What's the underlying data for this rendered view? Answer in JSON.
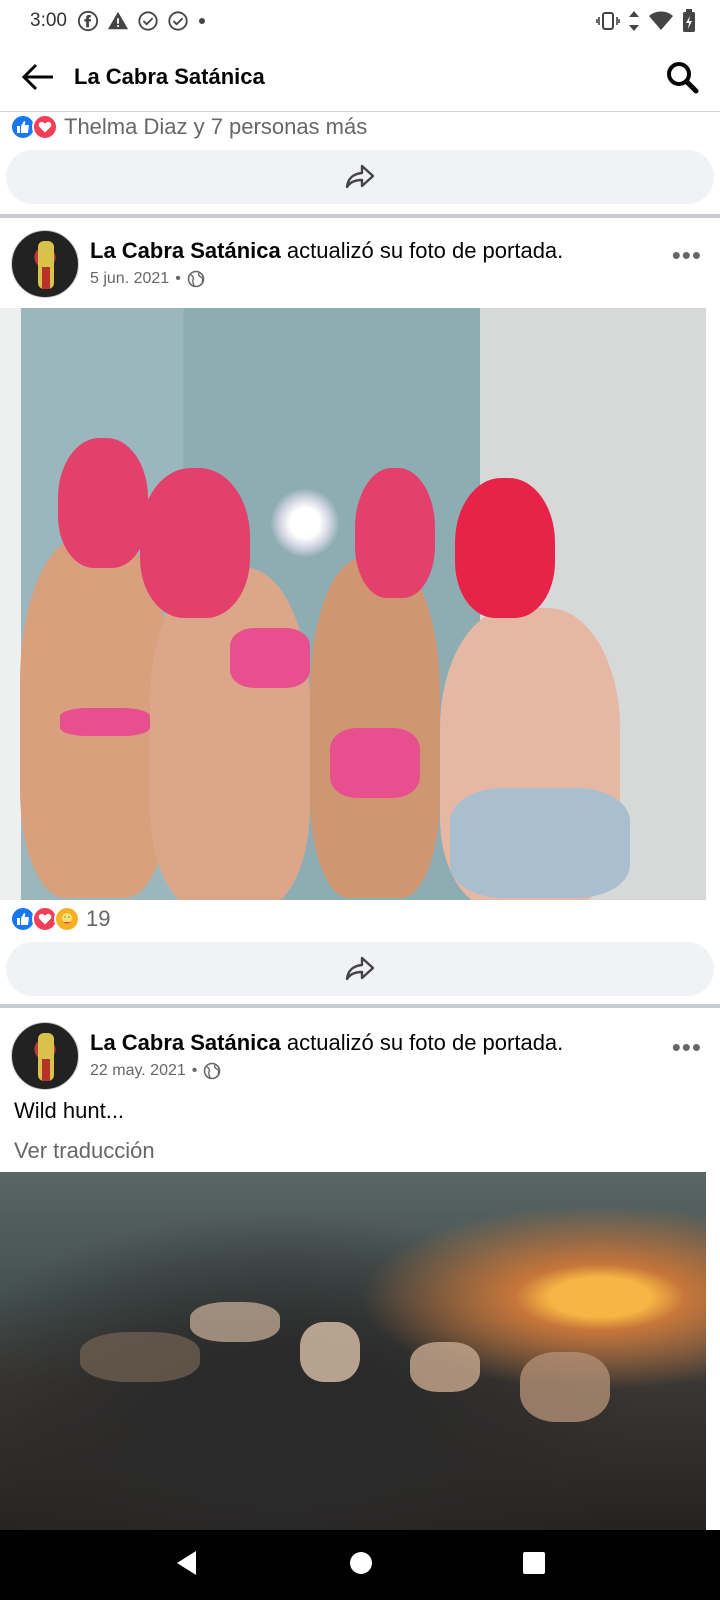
{
  "status_bar": {
    "time": "3:00",
    "left_icons": [
      "facebook-icon",
      "alert-icon",
      "check-circle-icon",
      "check-circle-icon",
      "dot-icon"
    ],
    "right_icons": [
      "vibrate-icon",
      "data-arrows-icon",
      "wifi-icon",
      "battery-icon"
    ]
  },
  "app_bar": {
    "title": "La Cabra Satánica",
    "back_icon": "arrow-left-icon",
    "search_icon": "search-icon"
  },
  "previous_post": {
    "reactions": [
      "like",
      "love"
    ],
    "reaction_text": "Thelma Diaz y 7 personas más"
  },
  "posts": [
    {
      "author": "La Cabra Satánica",
      "action": "actualizó su foto de portada.",
      "date": "5 jun. 2021",
      "separator": "•",
      "audience_icon": "globe-icon",
      "reactions": [
        "like",
        "love",
        "care"
      ],
      "reaction_count": "19"
    },
    {
      "author": "La Cabra Satánica",
      "action": "actualizó su foto de portada.",
      "date": "22 may. 2021",
      "separator": "•",
      "audience_icon": "globe-icon",
      "text": "Wild hunt...",
      "translate_label": "Ver traducción"
    }
  ],
  "more_label": "•••",
  "colors": {
    "like": "#1877f2",
    "love": "#f33e58",
    "care": "#f7b125",
    "secondary_text": "#65676b",
    "pill_bg": "#f0f2f5"
  }
}
